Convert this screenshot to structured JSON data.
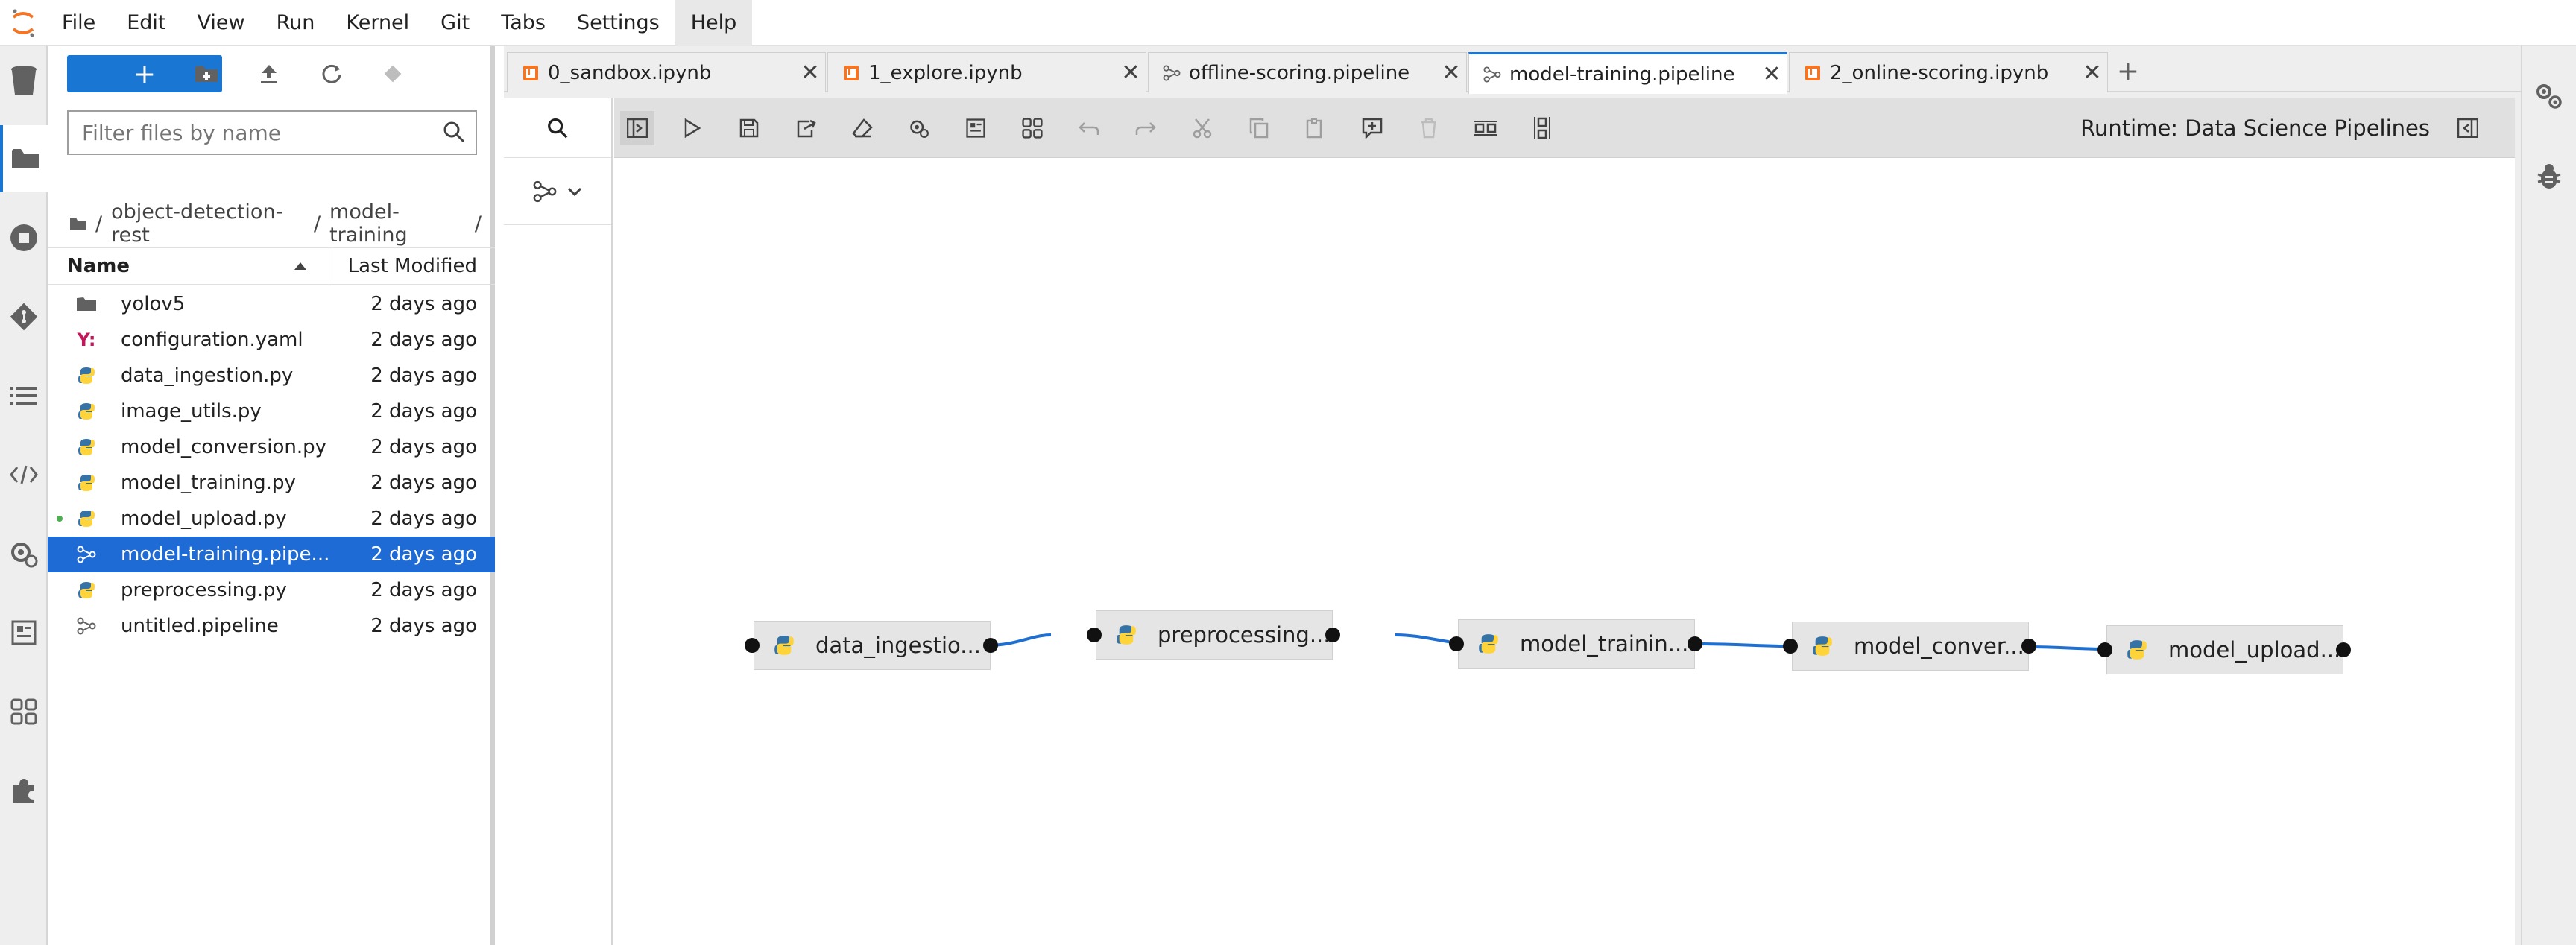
{
  "menu": [
    "File",
    "Edit",
    "View",
    "Run",
    "Kernel",
    "Git",
    "Tabs",
    "Settings",
    "Help"
  ],
  "file_browser": {
    "new_button": "+",
    "filter_placeholder": "Filter files by name",
    "breadcrumb": [
      "/",
      "object-detection-rest",
      "/",
      "model-training",
      "/"
    ],
    "columns": {
      "name": "Name",
      "modified": "Last Modified"
    },
    "files": [
      {
        "name": "yolov5",
        "icon": "folder-icon",
        "modified": "2 days ago"
      },
      {
        "name": "configuration.yaml",
        "icon": "yaml-icon",
        "modified": "2 days ago"
      },
      {
        "name": "data_ingestion.py",
        "icon": "python-icon",
        "modified": "2 days ago"
      },
      {
        "name": "image_utils.py",
        "icon": "python-icon",
        "modified": "2 days ago"
      },
      {
        "name": "model_conversion.py",
        "icon": "python-icon",
        "modified": "2 days ago"
      },
      {
        "name": "model_training.py",
        "icon": "python-icon",
        "modified": "2 days ago"
      },
      {
        "name": "model_upload.py",
        "icon": "python-icon",
        "modified": "2 days ago"
      },
      {
        "name": "model-training.pipe...",
        "icon": "pipeline-icon",
        "modified": "2 days ago"
      },
      {
        "name": "preprocessing.py",
        "icon": "python-icon",
        "modified": "2 days ago"
      },
      {
        "name": "untitled.pipeline",
        "icon": "pipeline-icon",
        "modified": "2 days ago"
      }
    ]
  },
  "tabs": [
    {
      "label": "0_sandbox.ipynb",
      "icon": "notebook-icon"
    },
    {
      "label": "1_explore.ipynb",
      "icon": "notebook-icon"
    },
    {
      "label": "offline-scoring.pipeline",
      "icon": "pipeline-icon"
    },
    {
      "label": "model-training.pipeline",
      "icon": "pipeline-icon"
    },
    {
      "label": "2_online-scoring.ipynb",
      "icon": "notebook-icon"
    }
  ],
  "tab_close": "✕",
  "tab_add": "+",
  "pipeline": {
    "runtime": "Runtime: Data Science Pipelines",
    "nodes": [
      {
        "label": "data_ingestio..."
      },
      {
        "label": "preprocessing..."
      },
      {
        "label": "model_trainin..."
      },
      {
        "label": "model_conver..."
      },
      {
        "label": "model_upload..."
      }
    ]
  },
  "colors": {
    "accent": "#1976d2",
    "selected_row": "#1f6bd6",
    "link": "#1e6fd0"
  }
}
